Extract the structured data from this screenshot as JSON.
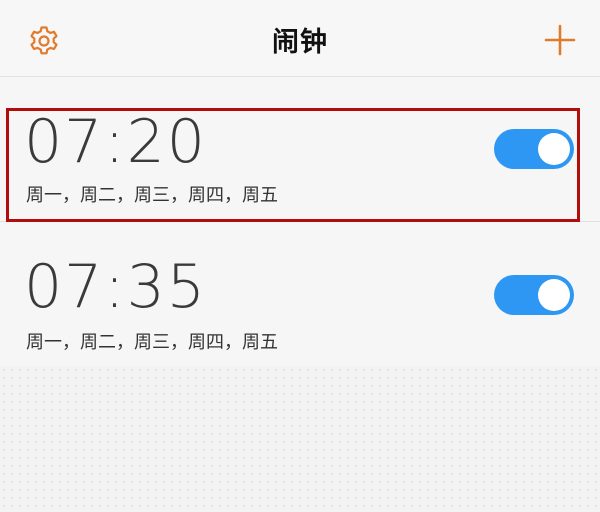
{
  "header": {
    "title": "闹钟",
    "settings_icon": "gear-icon",
    "add_icon": "plus-icon",
    "accent_color": "#e07b2d"
  },
  "alarms": [
    {
      "time": "07:20",
      "days": "周一，周二，周三，周四，周五",
      "enabled": true,
      "highlighted": true
    },
    {
      "time": "07:35",
      "days": "周一，周二，周三，周四，周五",
      "enabled": true,
      "highlighted": false
    }
  ],
  "colors": {
    "toggle_on": "#2d97f3",
    "highlight_border": "#b20d0d"
  }
}
